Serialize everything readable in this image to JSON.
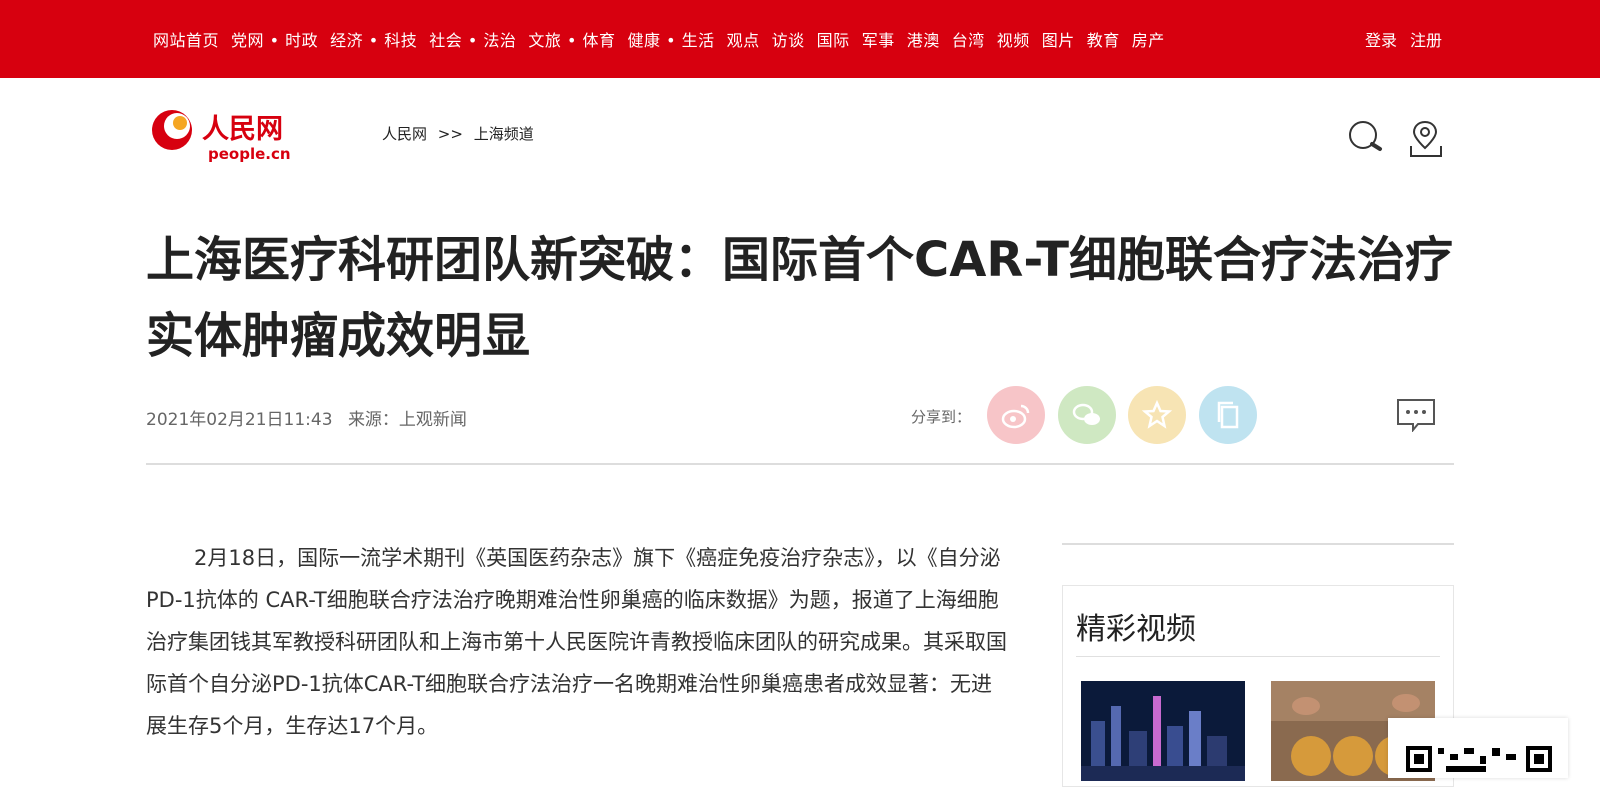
{
  "header": {
    "nav": [
      "网站首页",
      "党网 • 时政",
      "经济 • 科技",
      "社会 • 法治",
      "文旅 • 体育",
      "健康 • 生活",
      "观点",
      "访谈",
      "国际",
      "军事",
      "港澳",
      "台湾",
      "视频",
      "图片",
      "教育",
      "房产"
    ],
    "login": "登录",
    "register": "注册"
  },
  "logo": {
    "text_cn": "人民网",
    "text_en": "people.cn"
  },
  "breadcrumb": {
    "home": "人民网",
    "separator": ">>",
    "channel": "上海频道"
  },
  "article": {
    "title": "上海医疗科研团队新突破：国际首个CAR-T细胞联合疗法治疗实体肿瘤成效明显",
    "datetime": "2021年02月21日11:43",
    "source": "来源：上观新闻",
    "share_label": "分享到：",
    "paragraph": "2月18日，国际一流学术期刊《英国医药杂志》旗下《癌症免疫治疗杂志》，以《自分泌PD-1抗体的 CAR-T细胞联合疗法治疗晚期难治性卵巢癌的临床数据》为题，报道了上海细胞治疗集团钱其军教授科研团队和上海市第十人民医院许青教授临床团队的研究成果。其采取国际首个自分泌PD-1抗体CAR-T细胞联合疗法治疗一名晚期难治性卵巢癌患者成效显著：无进展生存5个月，生存达17个月。"
  },
  "sidebar": {
    "video_heading": "精彩视频"
  },
  "colors": {
    "brand_red": "#d7000f",
    "weibo": "#f7c5c8",
    "wechat": "#cfe8c2",
    "favorite": "#f7e4b4",
    "copy": "#bfe3f0"
  }
}
